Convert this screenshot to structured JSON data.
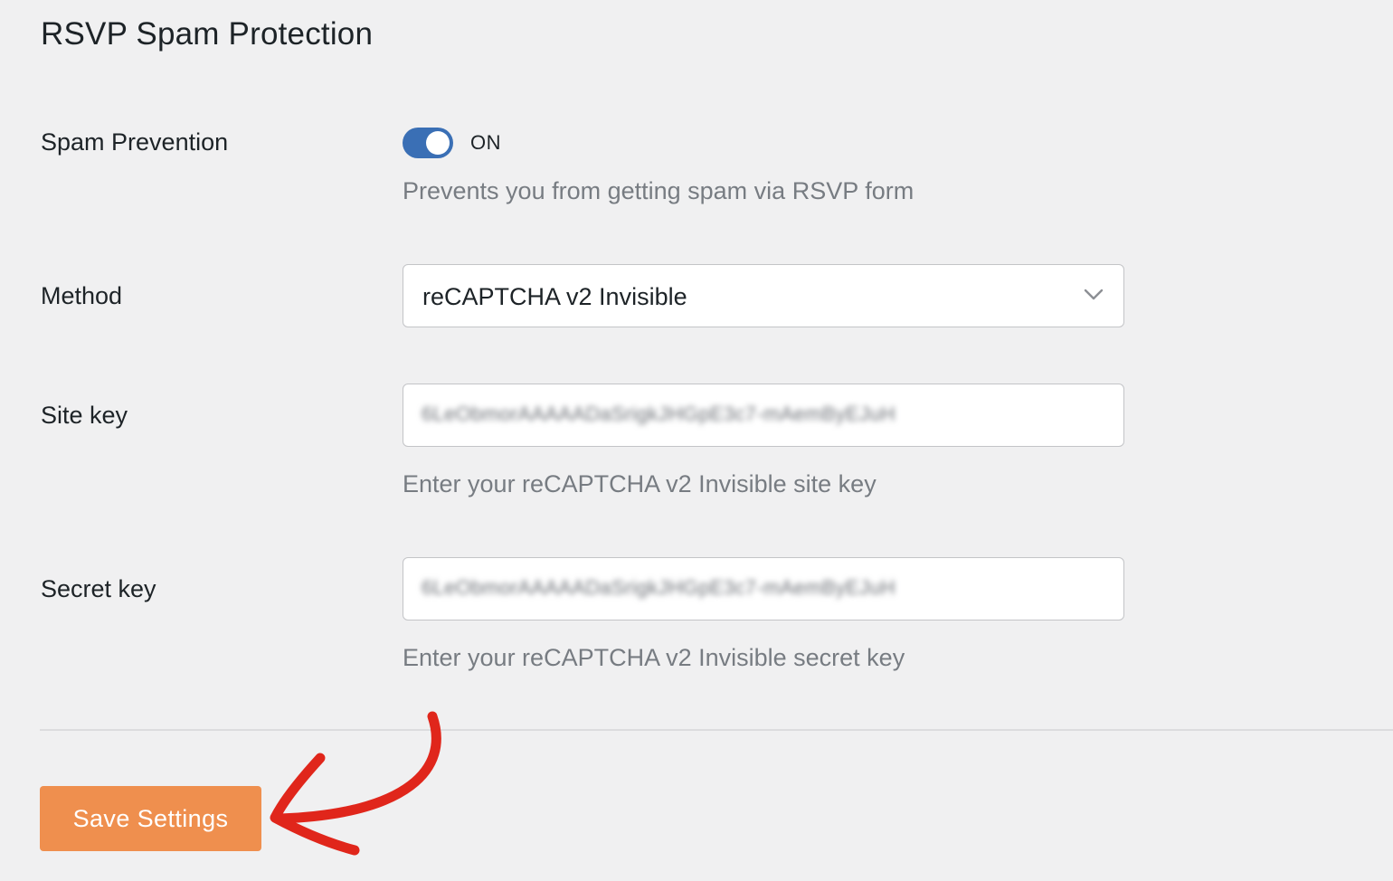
{
  "page": {
    "title": "RSVP Spam Protection"
  },
  "spam_prevention": {
    "label": "Spam Prevention",
    "toggle_state": "ON",
    "enabled": true,
    "help": "Prevents you from getting spam via RSVP form"
  },
  "method": {
    "label": "Method",
    "selected": "reCAPTCHA v2 Invisible"
  },
  "site_key": {
    "label": "Site key",
    "value_blurred": "6LeObmorAAAAADaSrigkJHGpE3c7-mAemByEJuH",
    "help": "Enter your reCAPTCHA v2 Invisible site key"
  },
  "secret_key": {
    "label": "Secret key",
    "value_blurred": "6LeObmorAAAAADaSrigkJHGpE3c7-mAemByEJuH",
    "help": "Enter your reCAPTCHA v2 Invisible secret key"
  },
  "actions": {
    "save_label": "Save Settings"
  },
  "colors": {
    "toggle_on": "#3a6fb5",
    "save_button": "#ef8f4e",
    "annotation_arrow": "#e0261b",
    "background": "#f0f0f1"
  },
  "icons": {
    "select_chevron": "chevron-down-icon",
    "annotation": "curved-arrow-icon"
  }
}
